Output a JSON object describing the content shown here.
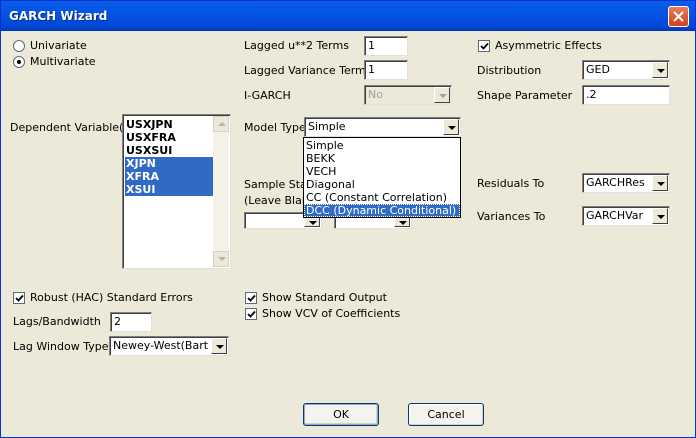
{
  "window": {
    "title": "GARCH Wizard"
  },
  "model_kind": {
    "options": [
      "Univariate",
      "Multivariate"
    ],
    "selected": "Multivariate"
  },
  "dependent": {
    "label": "Dependent Variable(s)",
    "items": [
      {
        "label": "USXJPN",
        "selected": false
      },
      {
        "label": "USXFRA",
        "selected": false
      },
      {
        "label": "USXSUI",
        "selected": false
      },
      {
        "label": "XJPN",
        "selected": true
      },
      {
        "label": "XFRA",
        "selected": true
      },
      {
        "label": "XSUI",
        "selected": true
      }
    ]
  },
  "params": {
    "lagged_u2_label": "Lagged u**2 Terms",
    "lagged_u2_value": "1",
    "lagged_var_label": "Lagged Variance Terms",
    "lagged_var_value": "1",
    "igarch_label": "I-GARCH",
    "igarch_value": "No",
    "model_type_label": "Model Type",
    "model_type_value": "Simple",
    "model_type_options": [
      "Simple",
      "BEKK",
      "VECH",
      "Diagonal",
      "CC (Constant Correlation)",
      "DCC (Dynamic Conditional)"
    ],
    "model_type_highlighted": "DCC (Dynamic Conditional)",
    "sample_label_1": "Sample Start",
    "sample_label_2": "(Leave Blank"
  },
  "right": {
    "asymmetric_label": "Asymmetric Effects",
    "asymmetric_checked": true,
    "distribution_label": "Distribution",
    "distribution_value": "GED",
    "shape_label": "Shape Parameter",
    "shape_value": ".2",
    "residuals_label": "Residuals To",
    "residuals_value": "GARCHRes",
    "variances_label": "Variances To",
    "variances_value": "GARCHVar"
  },
  "bottom": {
    "robust_label": "Robust (HAC) Standard Errors",
    "robust_checked": true,
    "lags_label": "Lags/Bandwidth",
    "lags_value": "2",
    "lagwin_label": "Lag Window Type",
    "lagwin_value": "Newey-West(Bartlett)",
    "show_output_label": "Show Standard Output",
    "show_output_checked": true,
    "show_vcv_label": "Show VCV of Coefficients",
    "show_vcv_checked": true
  },
  "buttons": {
    "ok": "OK",
    "cancel": "Cancel"
  },
  "icons": {
    "close": "close-x-icon",
    "dropdown": "chevron-down-icon",
    "check": "checkmark-icon"
  },
  "colors": {
    "selection": "#316ac5",
    "titlebar": "#0355e6",
    "dialog": "#ece9d8"
  }
}
